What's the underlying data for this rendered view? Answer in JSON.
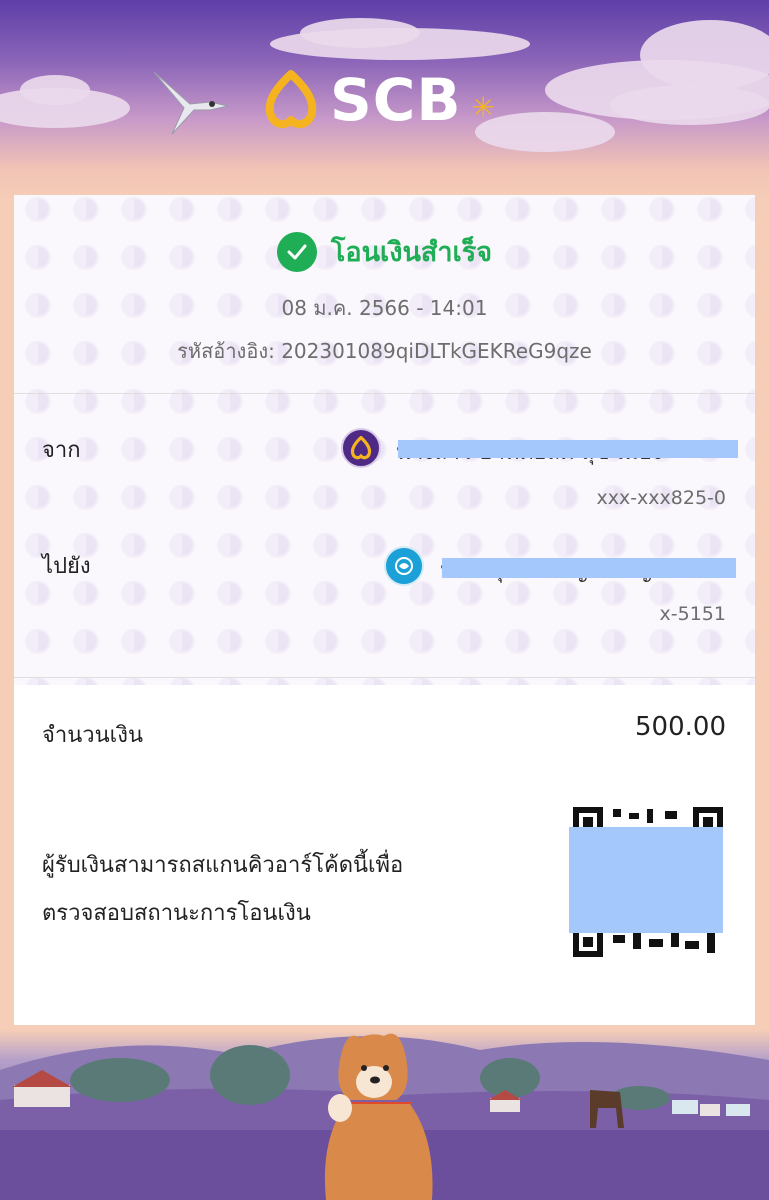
{
  "header": {
    "brand": "SCB"
  },
  "status": {
    "title": "โอนเงินสำเร็จ",
    "datetime": "08 ม.ค. 2566 - 14:01",
    "reference_label": "รหัสอ้างอิง:",
    "reference": "202301089qiDLTkGEKReG9qze"
  },
  "from": {
    "label": "จาก",
    "name": "นางสาว อาทิตยลด สุข เมือง",
    "account": "xxx-xxx825-0"
  },
  "to": {
    "label": "ไปยัง",
    "name": "น.ส. ศุภศิริกาญจ กาญจนา",
    "account": "x-5151"
  },
  "amount": {
    "label": "จำนวนเงิน",
    "value": "500.00"
  },
  "qr_note": {
    "line1": "ผู้รับเงินสามารถสแกนคิวอาร์โค้ดนี้เพื่อ",
    "line2": "ตรวจสอบสถานะการโอนเงิน"
  },
  "colors": {
    "success": "#1fae55",
    "scb_purple": "#4e2a84",
    "kbank_blue": "#1ba0d7",
    "redaction": "#a4c8fc"
  }
}
